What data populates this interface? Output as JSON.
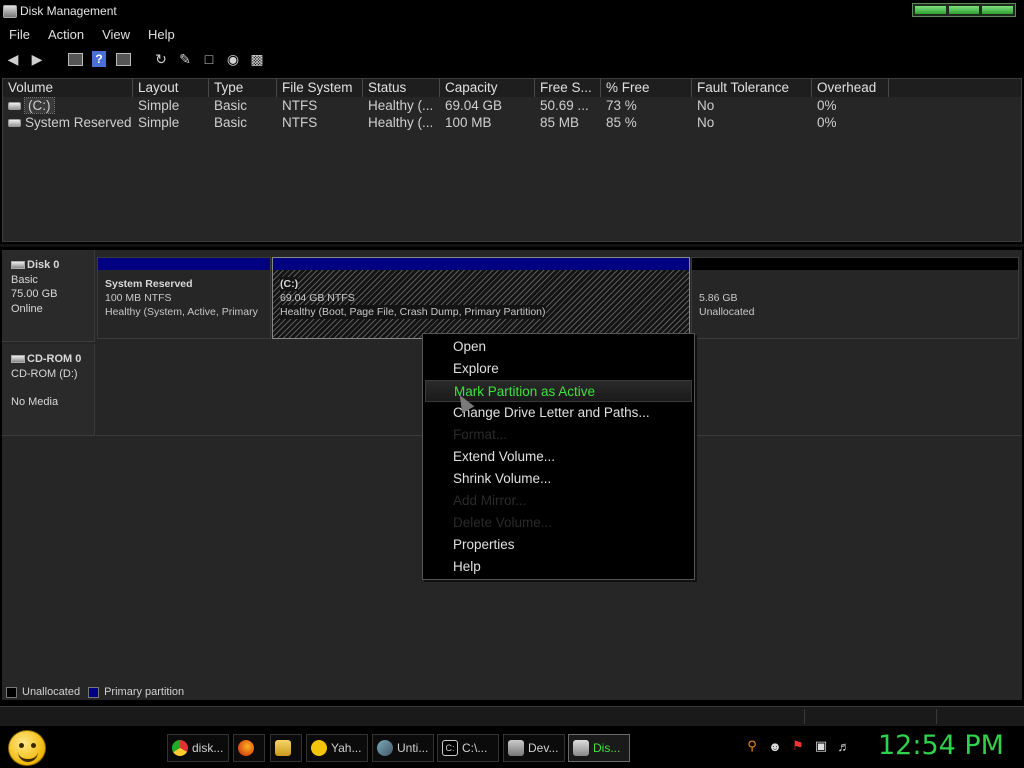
{
  "window": {
    "title": "Disk Management"
  },
  "menu": [
    "File",
    "Action",
    "View",
    "Help"
  ],
  "toolbar": {
    "icons": [
      "back-icon",
      "forward-icon",
      "console-icon",
      "help-icon",
      "properties-icon",
      "refresh-icon",
      "rescan-icon",
      "folder-icon",
      "search-icon",
      "settings-icon"
    ]
  },
  "volume_list": {
    "columns": [
      "Volume",
      "Layout",
      "Type",
      "File System",
      "Status",
      "Capacity",
      "Free S...",
      "% Free",
      "Fault Tolerance",
      "Overhead"
    ],
    "rows": [
      [
        "(C:)",
        "Simple",
        "Basic",
        "NTFS",
        "Healthy (...",
        "69.04 GB",
        "50.69 ...",
        "73 %",
        "No",
        "0%"
      ],
      [
        "System Reserved",
        "Simple",
        "Basic",
        "NTFS",
        "Healthy (...",
        "100 MB",
        "85 MB",
        "85 %",
        "No",
        "0%"
      ]
    ]
  },
  "disks": [
    {
      "name": "Disk 0",
      "type": "Basic",
      "size": "75.00 GB",
      "status": "Online",
      "partitions": [
        {
          "name": "System Reserved",
          "size_fs": "100 MB NTFS",
          "status": "Healthy (System, Active, Primary"
        },
        {
          "name": "(C:)",
          "size_fs": "69.04 GB NTFS",
          "status": "Healthy (Boot, Page File, Crash Dump, Primary Partition)"
        },
        {
          "name": "",
          "size_fs": "5.86 GB",
          "status": "Unallocated"
        }
      ]
    },
    {
      "name": "CD-ROM 0",
      "type": "CD-ROM (D:)",
      "status": "No Media"
    }
  ],
  "legend": [
    {
      "label": "Unallocated",
      "color": "#000000"
    },
    {
      "label": "Primary partition",
      "color": "#000080"
    }
  ],
  "context_menu": {
    "items": [
      {
        "label": "Open",
        "state": "enabled"
      },
      {
        "label": "Explore",
        "state": "enabled"
      },
      {
        "label": "Mark Partition as Active",
        "state": "highlighted"
      },
      {
        "label": "Change Drive Letter and Paths...",
        "state": "enabled"
      },
      {
        "label": "Format...",
        "state": "disabled"
      },
      {
        "label": "Extend Volume...",
        "state": "enabled"
      },
      {
        "label": "Shrink Volume...",
        "state": "enabled"
      },
      {
        "label": "Add Mirror...",
        "state": "disabled"
      },
      {
        "label": "Delete Volume...",
        "state": "disabled"
      },
      {
        "label": "Properties",
        "state": "enabled"
      },
      {
        "label": "Help",
        "state": "enabled"
      }
    ]
  },
  "taskbar": {
    "tasks": [
      {
        "label": "disk...",
        "icon": "chrome-icon"
      },
      {
        "label": "",
        "icon": "firefox-icon"
      },
      {
        "label": "",
        "icon": "folder-icon"
      },
      {
        "label": "Yah...",
        "icon": "yahoo-messenger-icon"
      },
      {
        "label": "Unti...",
        "icon": "paint-icon"
      },
      {
        "label": "C:\\...",
        "icon": "command-prompt-icon"
      },
      {
        "label": "Dev...",
        "icon": "device-manager-icon"
      },
      {
        "label": "Dis...",
        "icon": "disk-management-icon"
      }
    ],
    "tray_icons": [
      "search-icon",
      "messenger-icon",
      "flag-icon",
      "network-icon",
      "volume-icon"
    ],
    "clock": "12:54 PM"
  },
  "colors": {
    "primary_partition": "#000080",
    "clock": "#2fd24a",
    "menu_highlight_text": "#3fe03f",
    "background": "#262626"
  }
}
